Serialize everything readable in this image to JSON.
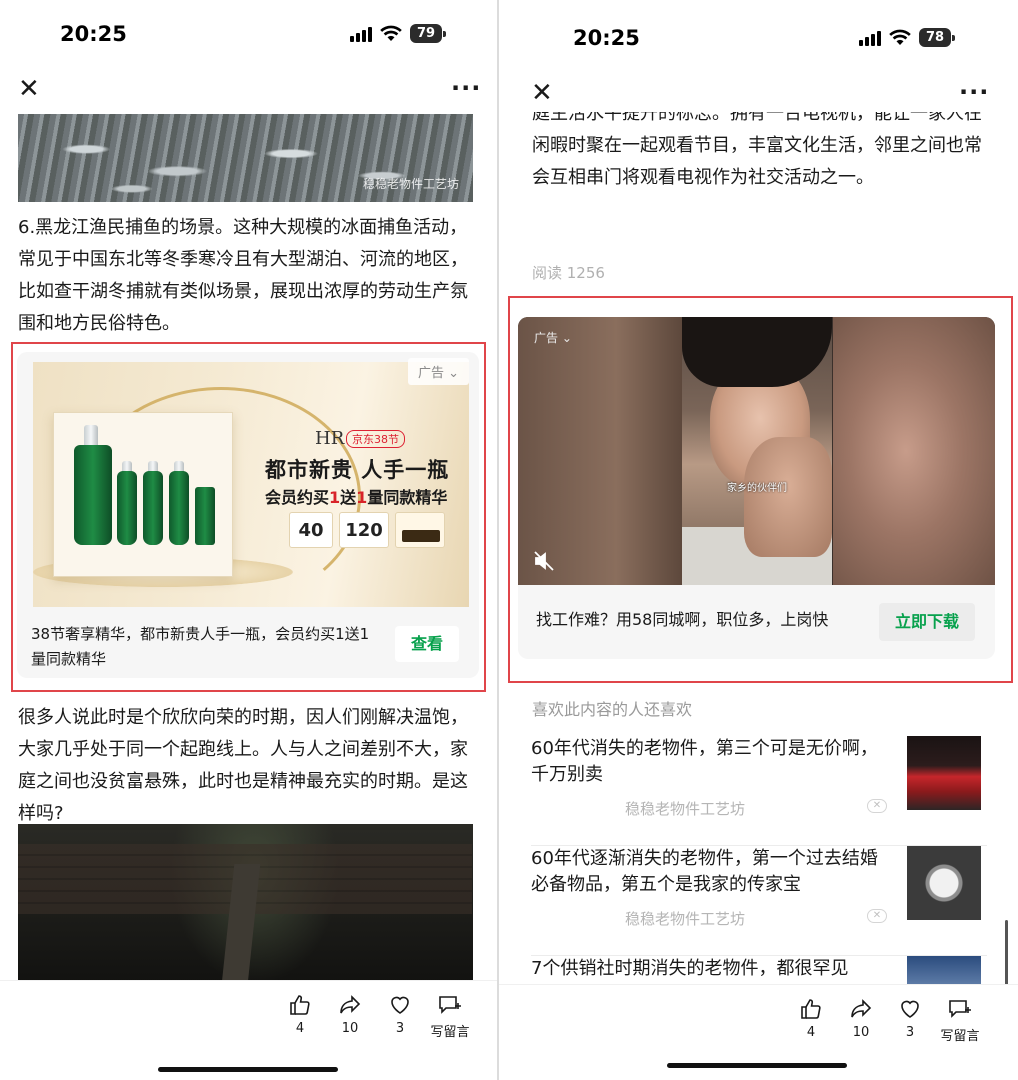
{
  "left": {
    "status": {
      "time": "20:25",
      "battery": "79"
    },
    "photo_top": {
      "caption": "稳稳老物件工艺坊"
    },
    "paragraph1": "6.黑龙江渔民捕鱼的场景。这种大规模的冰面捕鱼活动，常见于中国东北等冬季寒冷且有大型湖泊、河流的地区，比如查干湖冬捕就有类似场景，展现出浓厚的劳动生产氛围和地方民俗特色。",
    "ad": {
      "tag": "广告",
      "brand": "HR",
      "jd_badge": "京东38节",
      "headline": "都市新贵 人手一瓶",
      "subline_pre": "会员约买",
      "subline_red1": "1",
      "subline_mid": "送",
      "subline_red2": "1",
      "subline_post": "量同款精华",
      "price1": "40",
      "price2": "120",
      "description": "38节奢享精华，都市新贵人手一瓶，会员约买1送1量同款精华",
      "button": "查看"
    },
    "paragraph2": "很多人说此时是个欣欣向荣的时期，因人们刚解决温饱，大家几乎处于同一个起跑线上。人与人之间差别不大，家庭之间也没贫富悬殊，此时也是精神最充实的时期。是这样吗?",
    "actions": {
      "like": "4",
      "share": "10",
      "fav": "3",
      "comment": "写留言"
    }
  },
  "right": {
    "status": {
      "time": "20:25",
      "battery": "78"
    },
    "paragraph": "庭生活水平提升的标志。拥有一台电视机，能让一家人在闲暇时聚在一起观看节目，丰富文化生活，邻里之间也常会互相串门将观看电视作为社交活动之一。",
    "read_count": "阅读 1256",
    "ad": {
      "tag": "广告",
      "subtitle": "家乡的伙伴们",
      "description": "找工作难？用58同城啊，职位多，上岗快",
      "button": "立即下载"
    },
    "rec_title": "喜欢此内容的人还喜欢",
    "recommendations": [
      {
        "title": "60年代消失的老物件，第三个可是无价啊，千万别卖",
        "source": "稳稳老物件工艺坊"
      },
      {
        "title": "60年代逐渐消失的老物件，第一个过去结婚必备物品，第五个是我家的传家宝",
        "source": "稳稳老物件工艺坊"
      },
      {
        "title": "7个供销社时期消失的老物件，都很罕见",
        "source": ""
      }
    ],
    "actions": {
      "like": "4",
      "share": "10",
      "fav": "3",
      "comment": "写留言"
    }
  },
  "colors": {
    "accent_green": "#07a14c",
    "highlight_red": "#e0454a",
    "price_red": "#d8232a"
  }
}
